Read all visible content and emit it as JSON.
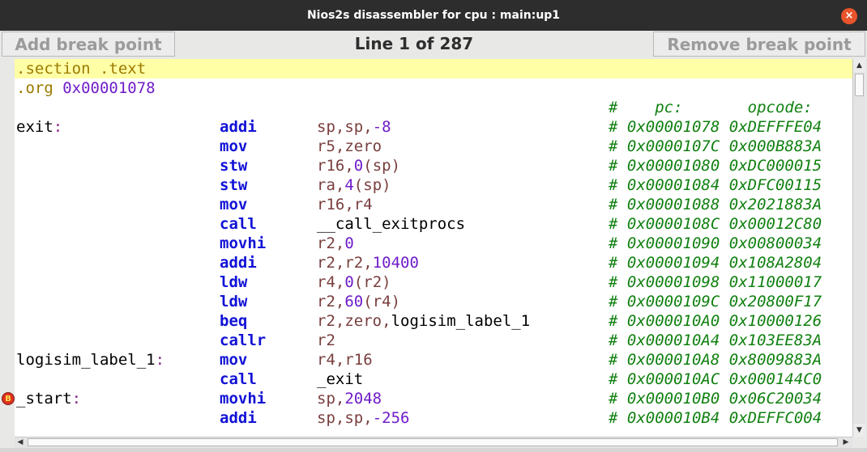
{
  "window": {
    "title": "Nios2s disassembler for cpu : main:up1",
    "close_glyph": "×"
  },
  "toolbar": {
    "add_label": "Add break point",
    "line_label": "Line 1 of 287",
    "remove_label": "Remove break point"
  },
  "header": {
    "section": ".section .text",
    "org_kw": ".org",
    "org_val": "0x00001078",
    "cm_hash": "#",
    "cm_pc": "pc:",
    "cm_opcode": "opcode:"
  },
  "breakpoint": {
    "icon": "breakpoint-icon",
    "glyph": "B"
  },
  "lines": [
    {
      "label": "exit",
      "op": "addi",
      "pc": "0x00001078",
      "opcode": "0xDEFFFE04"
    },
    {
      "label": "",
      "op": "mov",
      "pc": "0x0000107C",
      "opcode": "0x000B883A"
    },
    {
      "label": "",
      "op": "stw",
      "pc": "0x00001080",
      "opcode": "0xDC000015"
    },
    {
      "label": "",
      "op": "stw",
      "pc": "0x00001084",
      "opcode": "0xDFC00115"
    },
    {
      "label": "",
      "op": "mov",
      "pc": "0x00001088",
      "opcode": "0x2021883A"
    },
    {
      "label": "",
      "op": "call",
      "pc": "0x0000108C",
      "opcode": "0x00012C80"
    },
    {
      "label": "",
      "op": "movhi",
      "pc": "0x00001090",
      "opcode": "0x00800034"
    },
    {
      "label": "",
      "op": "addi",
      "pc": "0x00001094",
      "opcode": "0x108A2804"
    },
    {
      "label": "",
      "op": "ldw",
      "pc": "0x00001098",
      "opcode": "0x11000017"
    },
    {
      "label": "",
      "op": "ldw",
      "pc": "0x0000109C",
      "opcode": "0x20800F17"
    },
    {
      "label": "",
      "op": "beq",
      "pc": "0x000010A0",
      "opcode": "0x10000126"
    },
    {
      "label": "",
      "op": "callr",
      "pc": "0x000010A4",
      "opcode": "0x103EE83A"
    },
    {
      "label": "logisim_label_1",
      "op": "mov",
      "pc": "0x000010A8",
      "opcode": "0x8009883A"
    },
    {
      "label": "",
      "op": "call",
      "pc": "0x000010AC",
      "opcode": "0x000144C0"
    },
    {
      "label": "_start",
      "op": "movhi",
      "pc": "0x000010B0",
      "opcode": "0x06C20034"
    },
    {
      "label": "",
      "op": "addi",
      "pc": "0x000010B4",
      "opcode": "0xDEFFC004"
    }
  ],
  "args": {
    "r0": {
      "a": "sp",
      "b": ",",
      "c": "sp",
      "d": ",",
      "e": "-8"
    },
    "r1": {
      "a": "r5",
      "b": ",",
      "c": "zero"
    },
    "r2": {
      "a": "r16",
      "b": ",",
      "c": "0",
      "d": "(",
      "e": "sp",
      "f": ")"
    },
    "r3": {
      "a": "ra",
      "b": ",",
      "c": "4",
      "d": "(",
      "e": "sp",
      "f": ")"
    },
    "r4": {
      "a": "r16",
      "b": ",",
      "c": "r4"
    },
    "r5": {
      "a": "__call_exitprocs"
    },
    "r6": {
      "a": "r2",
      "b": ",",
      "c": "0"
    },
    "r7": {
      "a": "r2",
      "b": ",",
      "c": "r2",
      "d": ",",
      "e": "10400"
    },
    "r8": {
      "a": "r4",
      "b": ",",
      "c": "0",
      "d": "(",
      "e": "r2",
      "f": ")"
    },
    "r9": {
      "a": "r2",
      "b": ",",
      "c": "60",
      "d": "(",
      "e": "r4",
      "f": ")"
    },
    "r10": {
      "a": "r2",
      "b": ",",
      "c": "zero",
      "d": ",",
      "e": "logisim_label_1"
    },
    "r11": {
      "a": "r2"
    },
    "r12": {
      "a": "r4",
      "b": ",",
      "c": "r16"
    },
    "r13": {
      "a": "_exit"
    },
    "r14": {
      "a": "sp",
      "b": ",",
      "c": "2048"
    },
    "r15": {
      "a": "sp",
      "b": ",",
      "c": "sp",
      "d": ",",
      "e": "-256"
    }
  },
  "colon": ":",
  "hash": "#"
}
